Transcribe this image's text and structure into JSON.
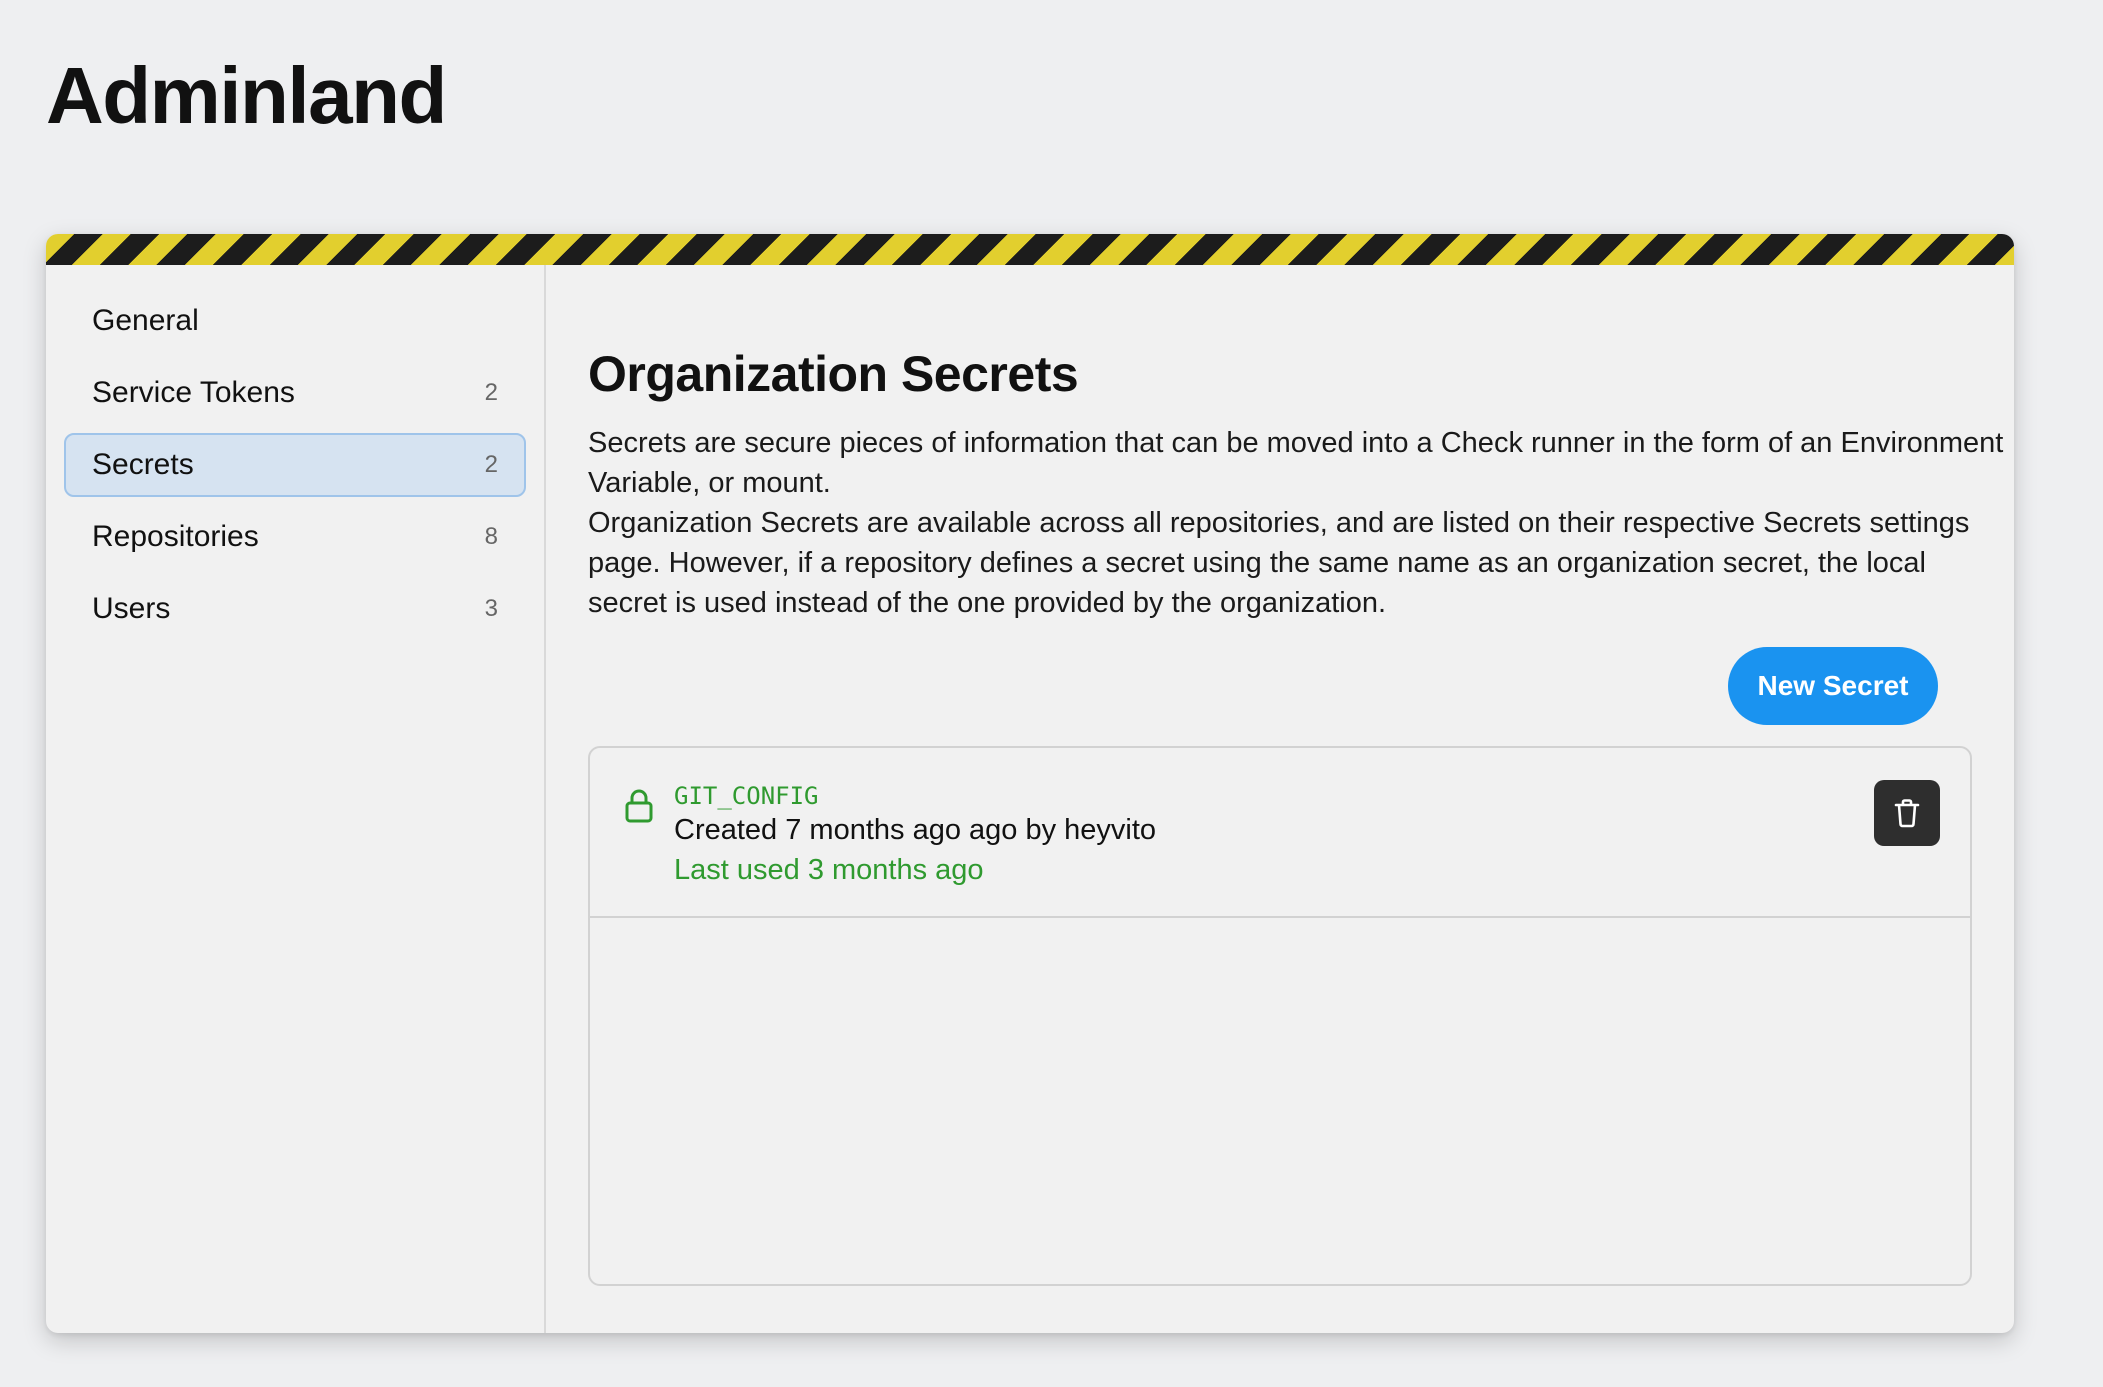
{
  "app": {
    "title": "Adminland"
  },
  "sidebar": {
    "items": [
      {
        "label": "General",
        "count": ""
      },
      {
        "label": "Service Tokens",
        "count": "2"
      },
      {
        "label": "Secrets",
        "count": "2",
        "active": true
      },
      {
        "label": "Repositories",
        "count": "8"
      },
      {
        "label": "Users",
        "count": "3"
      }
    ]
  },
  "main": {
    "title": "Organization Secrets",
    "description_1": "Secrets are secure pieces of information that can be moved into a Check runner in the form of an Environment Variable, or mount.",
    "description_2": "Organization Secrets are available across all repositories, and are listed on their respective Secrets settings page. However, if a repository defines a secret using the same name as an organization secret, the local secret is used instead of the one provided by the organization.",
    "new_button": "New Secret",
    "secrets": [
      {
        "name": "GIT_CONFIG",
        "created": "Created 7 months ago ago by heyvito",
        "last_used": "Last used 3 months ago",
        "icon": "lock-icon",
        "delete_icon": "trash-icon"
      }
    ]
  },
  "colors": {
    "accent": "#1a93f0",
    "success": "#2f9a2f",
    "hazard_yellow": "#e2cf2e",
    "hazard_black": "#1c1c1c",
    "active_bg": "#d6e3f1"
  }
}
